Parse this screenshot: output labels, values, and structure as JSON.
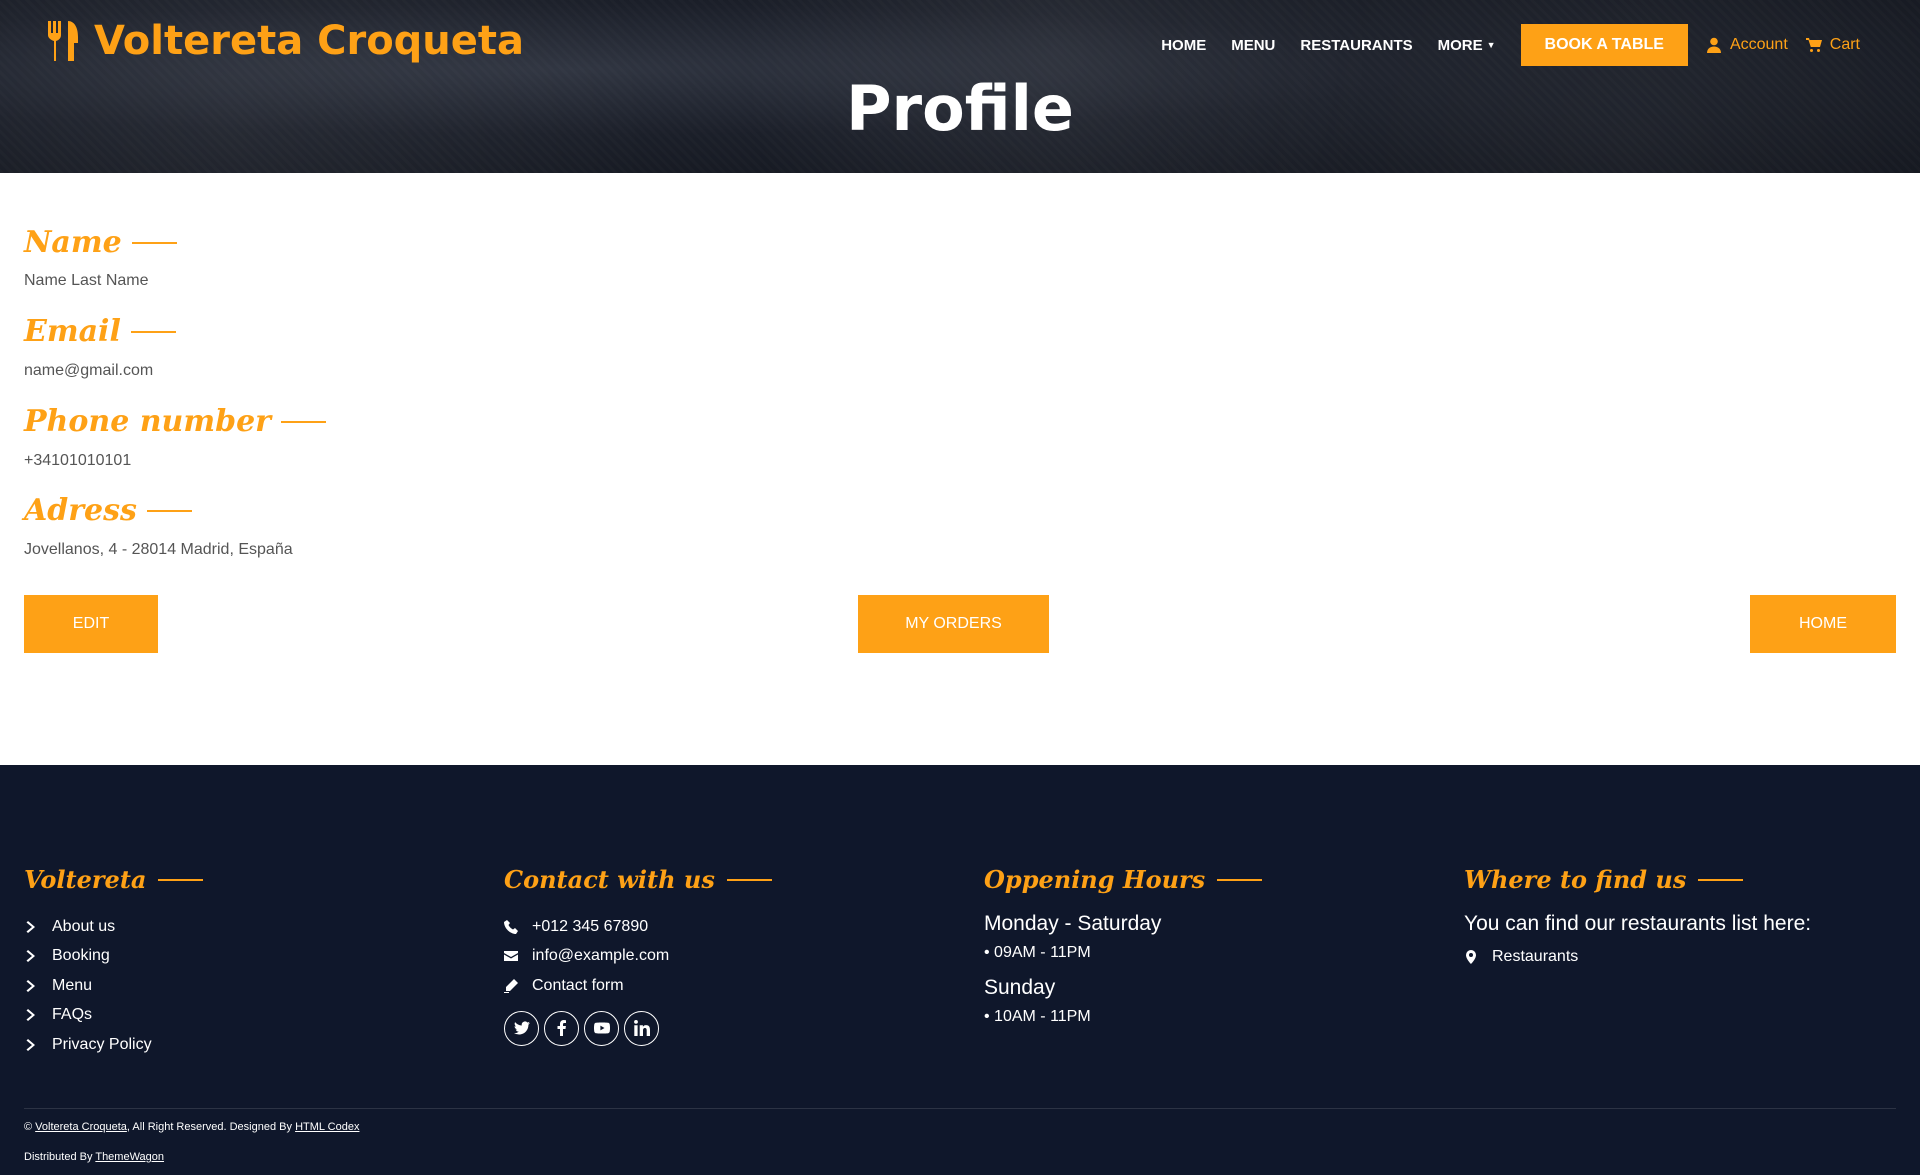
{
  "header": {
    "brand": "Voltereta Croqueta",
    "nav": [
      "HOME",
      "MENU",
      "RESTAURANTS",
      "MORE"
    ],
    "book_label": "BOOK A TABLE",
    "account_label": "Account",
    "cart_label": "Cart",
    "page_title": "Profile"
  },
  "profile": {
    "name_title": "Name",
    "name_value": "Name Last Name",
    "email_title": "Email",
    "email_value": "name@gmail.com",
    "phone_title": "Phone number",
    "phone_value": "+34101010101",
    "address_title": "Adress",
    "address_value": "Jovellanos, 4 - 28014 Madrid, España",
    "edit_label": "EDIT",
    "orders_label": "MY ORDERS",
    "home_label": "HOME"
  },
  "footer": {
    "col1_title": "Voltereta",
    "col1_links": [
      "About us",
      "Booking",
      "Menu",
      "FAQs",
      "Privacy Policy"
    ],
    "col2_title": "Contact with us",
    "phone": "+012 345 67890",
    "email": "info@example.com",
    "contact_form": "Contact form",
    "col3_title": "Oppening Hours",
    "day1": "Monday - Saturday",
    "time1": "• 09AM - 11PM",
    "day2": "Sunday",
    "time2": "• 10AM - 11PM",
    "col4_title": "Where to find us",
    "find_text": "You can find our restaurants list here:",
    "restaurants_link": "Restaurants",
    "copyright_prefix": "©",
    "copyright_brand": "Voltereta Croqueta",
    "copyright_mid": ", All Right Reserved. Designed By",
    "copyright_designer": "HTML Codex",
    "distributed_prefix": "Distributed By",
    "distributor": "ThemeWagon"
  },
  "colors": {
    "accent": "#FEA116",
    "footer_bg": "#0F172B"
  }
}
